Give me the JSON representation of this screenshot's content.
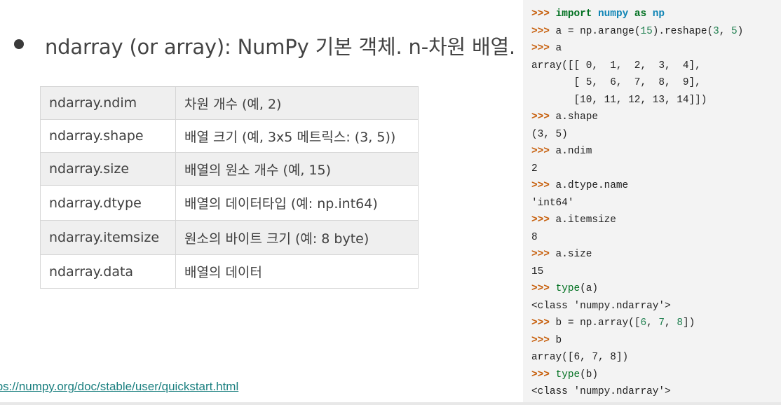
{
  "headline": "ndarray (or array): NumPy 기본 객체. n-차원 배열.",
  "attributes": [
    {
      "name": "ndarray.ndim",
      "desc": "차원 개수 (예, 2)"
    },
    {
      "name": "ndarray.shape",
      "desc": "배열 크기 (예, 3x5 메트릭스: (3, 5))"
    },
    {
      "name": "ndarray.size",
      "desc": "배열의 원소 개수 (예, 15)"
    },
    {
      "name": "ndarray.dtype",
      "desc": "배열의 데이터타입 (예: np.int64)"
    },
    {
      "name": "ndarray.itemsize",
      "desc": "원소의 바이트 크기 (예: 8 byte)"
    },
    {
      "name": "ndarray.data",
      "desc": "배열의 데이터"
    }
  ],
  "link_text": "tps://numpy.org/doc/stable/user/quickstart.html",
  "code": {
    "lines": [
      ">>> import numpy as np",
      ">>> a = np.arange(15).reshape(3, 5)",
      ">>> a",
      "array([[ 0,  1,  2,  3,  4],",
      "       [ 5,  6,  7,  8,  9],",
      "       [10, 11, 12, 13, 14]])",
      ">>> a.shape",
      "(3, 5)",
      ">>> a.ndim",
      "2",
      ">>> a.dtype.name",
      "'int64'",
      ">>> a.itemsize",
      "8",
      ">>> a.size",
      "15",
      ">>> type(a)",
      "<class 'numpy.ndarray'>",
      ">>> b = np.array([6, 7, 8])",
      ">>> b",
      "array([6, 7, 8])",
      ">>> type(b)",
      "<class 'numpy.ndarray'>"
    ]
  }
}
